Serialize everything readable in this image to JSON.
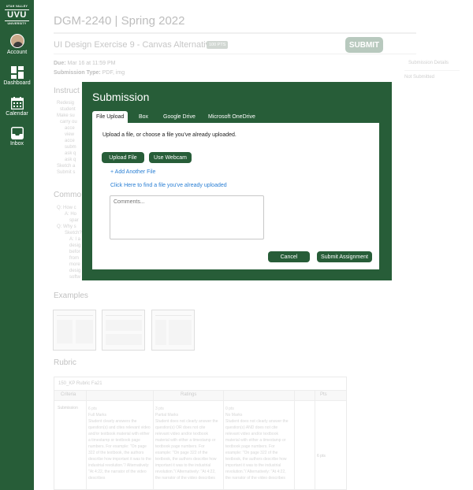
{
  "sidebar": {
    "logo": {
      "top": "UTAH VALLEY",
      "mid": "UVU",
      "bot": "UNIVERSITY"
    },
    "items": [
      {
        "label": "Account",
        "icon": "avatar"
      },
      {
        "label": "Dashboard",
        "icon": "dashboard-icon"
      },
      {
        "label": "Calendar",
        "icon": "calendar-icon"
      },
      {
        "label": "Inbox",
        "icon": "inbox-icon"
      }
    ]
  },
  "page": {
    "course_title": "DGM-2240 | Spring 2022",
    "assignment_title": "UI Design Exercise 9 - Canvas Alternative",
    "points_badge": "100 PTS",
    "submit_label": "SUBMIT",
    "due_label": "Due:",
    "due_value": "Mar 16 at 11:59 PM",
    "submission_type_label": "Submission Type:",
    "submission_type_value": "PDF, img",
    "side_title": "Submission Details",
    "side_value": "Not Submitted",
    "instructions_heading": "Instruct",
    "comments_heading": "Commo",
    "examples_heading": "Examples",
    "rubric_heading": "Rubric",
    "instructions_lines": [
      "Redesig",
      "student",
      "Make su",
      "carry ou",
      "acce",
      "view",
      "acce",
      "subm",
      "ask q",
      "ask q",
      "Sketch a",
      "Submit s"
    ],
    "comments_lines": [
      "Q: How c",
      "A: Ho",
      "spar",
      "Q: Why s",
      "Sketch?",
      "A: I a",
      "desig",
      "befor",
      "from",
      "more",
      "desig",
      "softw"
    ],
    "rubric": {
      "name": "150_KP Rubric Fa21",
      "col_criteria": "Criteria",
      "col_ratings": "Ratings",
      "col_pts": "Pts",
      "row_label": "Submission",
      "ratings": [
        {
          "pts": "6 pts",
          "title": "Full Marks",
          "desc": "Student clearly answers the question(s) and cites relevant video and/or textbook material with either a timestamp or textbook page numbers. For example: ''On page 322 of the textbook, the authors describe how important it was to the industrial revolution.''/ Alternatively: ''At 4:22, the narrator of the video describes"
        },
        {
          "pts": "3 pts",
          "title": "Partial Marks",
          "desc": "Student does not clearly answer the question(s) OR does not cite relevant video and/or textbook material with either a timestamp or textbook page numbers. For example: ''On page 322 of the textbook, the authors describe how important it was to the industrial revolution.''/ Alternatively: ''At 4:22, the narrator of the video describes"
        },
        {
          "pts": "0 pts",
          "title": "No Marks",
          "desc": "Student does not clearly answer the question(s) AND does not cite relevant video and/or textbook material with either a timestamp or textbook page numbers. For example: ''On page 322 of the textbook, the authors describe how important it was to the industrial revolution.''/ Alternatively: ''At 4:22, the narrator of the video describes"
        }
      ],
      "row_pts": "6 pts"
    }
  },
  "modal": {
    "title": "Submission",
    "tabs": [
      "File Upload",
      "Box",
      "Google Drive",
      "Microsoft OneDrive"
    ],
    "instruction": "Upload a file, or choose a file you've already uploaded.",
    "upload_button": "Upload File",
    "webcam_button": "Use Webcam",
    "add_another": "+ Add Another File",
    "find_link": "Click Here to find a file you've already uploaded",
    "comments_placeholder": "Comments...",
    "cancel_button": "Cancel",
    "submit_button": "Submit Assignment"
  },
  "colors": {
    "brand": "#275d38",
    "link": "#2a7fd4"
  }
}
